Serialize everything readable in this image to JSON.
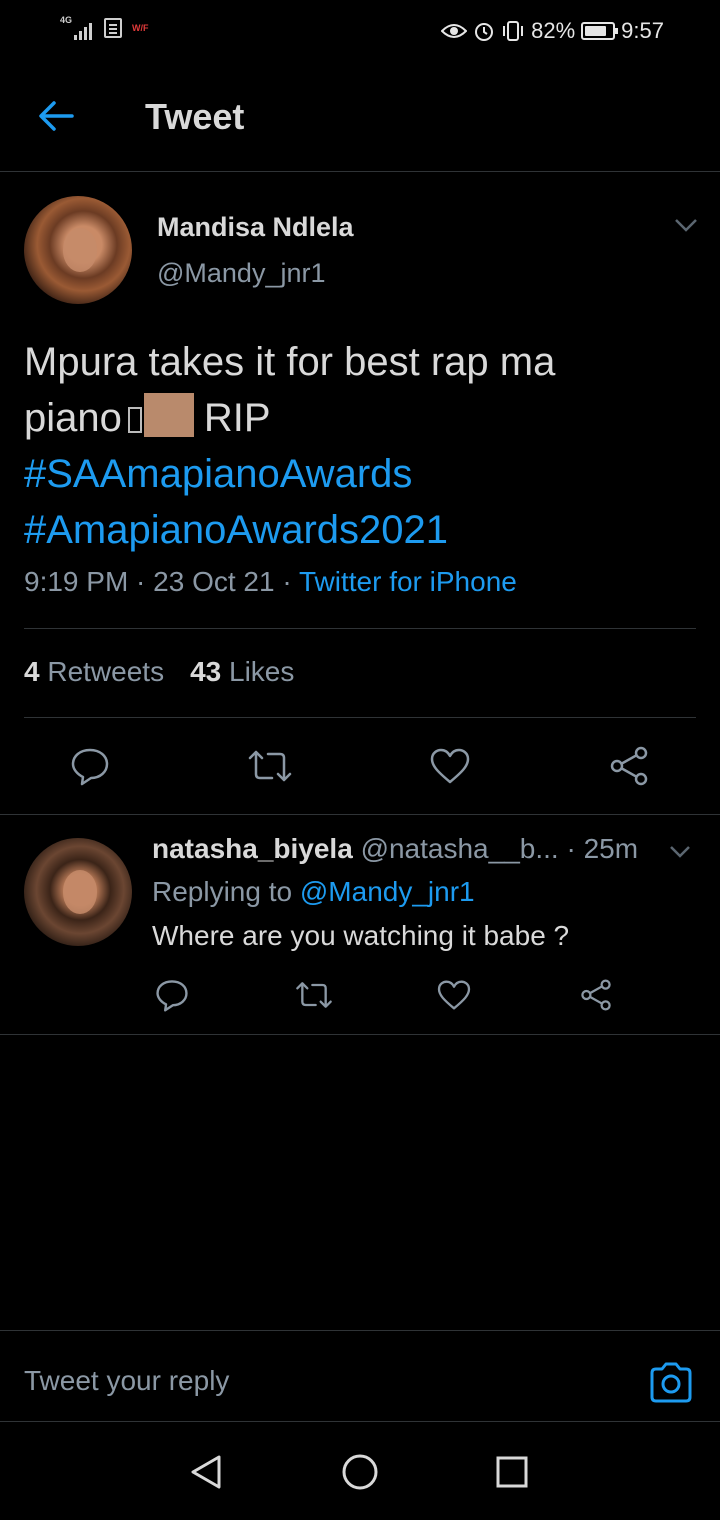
{
  "status_bar": {
    "network_label": "4G",
    "wifi_label": "W/F",
    "battery": "82%",
    "battery_level": 0.82,
    "time": "9:57"
  },
  "header": {
    "title": "Tweet"
  },
  "tweet": {
    "author_name": "Mandisa Ndlela",
    "author_handle": "@Mandy_jnr1",
    "text_line1": "Mpura takes it for best rap ma",
    "text_line2_a": "piano",
    "text_line2_b": "RIP",
    "hashtag1": "#SAAmapianoAwards",
    "hashtag2": "#AmapianoAwards2021",
    "time": "9:19 PM",
    "date": "23 Oct 21",
    "source": "Twitter for iPhone",
    "retweets_count": "4",
    "retweets_label": "Retweets",
    "likes_count": "43",
    "likes_label": "Likes"
  },
  "reply": {
    "name": "natasha_biyela",
    "handle": "@natasha__b...",
    "age": "25m",
    "replying_prefix": "Replying to",
    "replying_to": "@Mandy_jnr1",
    "text": "Where are you watching it babe ?"
  },
  "compose": {
    "placeholder": "Tweet your reply"
  },
  "colors": {
    "accent": "#1d9bf0",
    "background": "#000000",
    "text": "#d9d9d9",
    "muted": "#8b98a5"
  }
}
